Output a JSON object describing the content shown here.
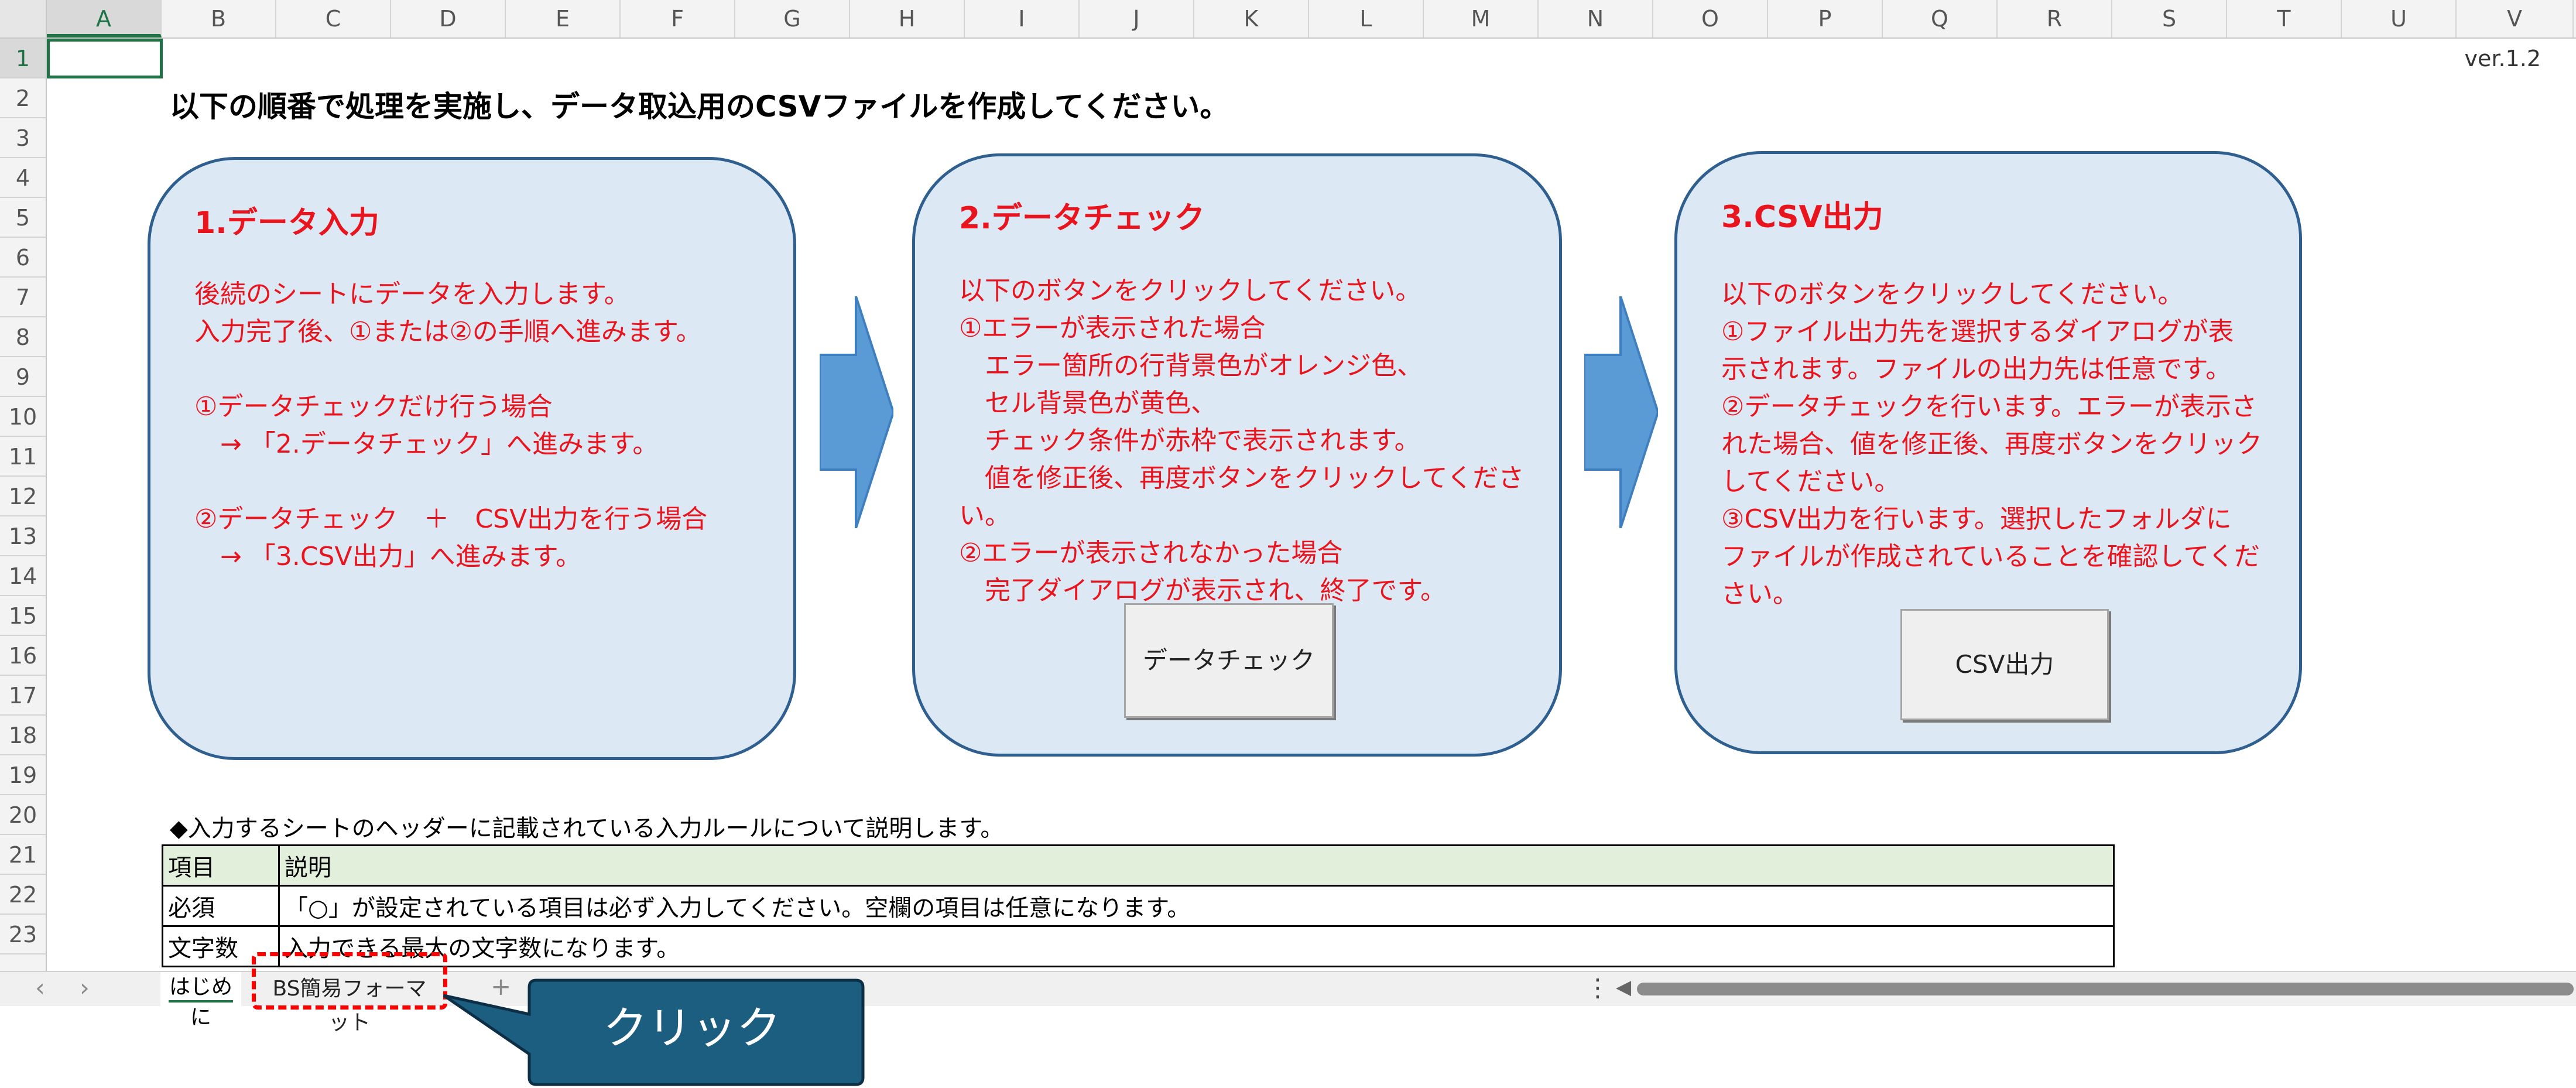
{
  "columns": [
    "A",
    "B",
    "C",
    "D",
    "E",
    "F",
    "G",
    "H",
    "I",
    "J",
    "K",
    "L",
    "M",
    "N",
    "O",
    "P",
    "Q",
    "R",
    "S",
    "T",
    "U",
    "V"
  ],
  "rows": [
    "1",
    "2",
    "3",
    "4",
    "5",
    "6",
    "7",
    "8",
    "9",
    "10",
    "11",
    "12",
    "13",
    "14",
    "15",
    "16",
    "17",
    "18",
    "19",
    "20",
    "21",
    "22",
    "23"
  ],
  "version": "ver.1.2",
  "heading": "以下の順番で処理を実施し、データ取込用のCSVファイルを作成してください。",
  "cards": [
    {
      "title": "1.データ入力",
      "lines": [
        "後続のシートにデータを入力します。",
        "入力完了後、①または②の手順へ進みます。",
        "",
        "①データチェックだけ行う場合",
        "　→ 「2.データチェック」へ進みます。",
        "",
        "②データチェック　＋　CSV出力を行う場合",
        "　→ 「3.CSV出力」へ進みます。"
      ]
    },
    {
      "title": "2.データチェック",
      "lines": [
        "以下のボタンをクリックしてください。",
        "①エラーが表示された場合",
        "　エラー箇所の行背景色がオレンジ色、",
        "　セル背景色が黄色、",
        "　チェック条件が赤枠で表示されます。",
        "　値を修正後、再度ボタンをクリックしてくださ",
        "い。",
        "②エラーが表示されなかった場合",
        "　完了ダイアログが表示され、終了です。"
      ],
      "button": "データチェック"
    },
    {
      "title": "3.CSV出力",
      "lines": [
        "以下のボタンをクリックしてください。",
        "①ファイル出力先を選択するダイアログが表",
        "示されます。ファイルの出力先は任意です。",
        "②データチェックを行います。エラーが表示さ",
        "れた場合、値を修正後、再度ボタンをクリック",
        "してください。",
        "③CSV出力を行います。選択したフォルダに",
        "ファイルが作成されていることを確認してくだ",
        "さい。"
      ],
      "button": "CSV出力"
    }
  ],
  "table_note": "◆入力するシートのヘッダーに記載されている入力ルールについて説明します。",
  "table": {
    "header": [
      "項目",
      "説明"
    ],
    "rows": [
      [
        "必須",
        "「○」が設定されている項目は必ず入力してください。空欄の項目は任意になります。"
      ],
      [
        "文字数",
        "入力できる最大の文字数になります。"
      ]
    ]
  },
  "sheet_tabs": [
    "はじめに",
    "BS簡易フォーマット"
  ],
  "callout": "クリック",
  "colors": {
    "card_fill": "#dde8f5",
    "card_border": "#2f5f8f",
    "card_text": "#e8151f",
    "arrow": "#5b9bd5",
    "callout_fill": "#1b5e80",
    "highlight": "#ff0000",
    "active_green": "#1f7244"
  }
}
